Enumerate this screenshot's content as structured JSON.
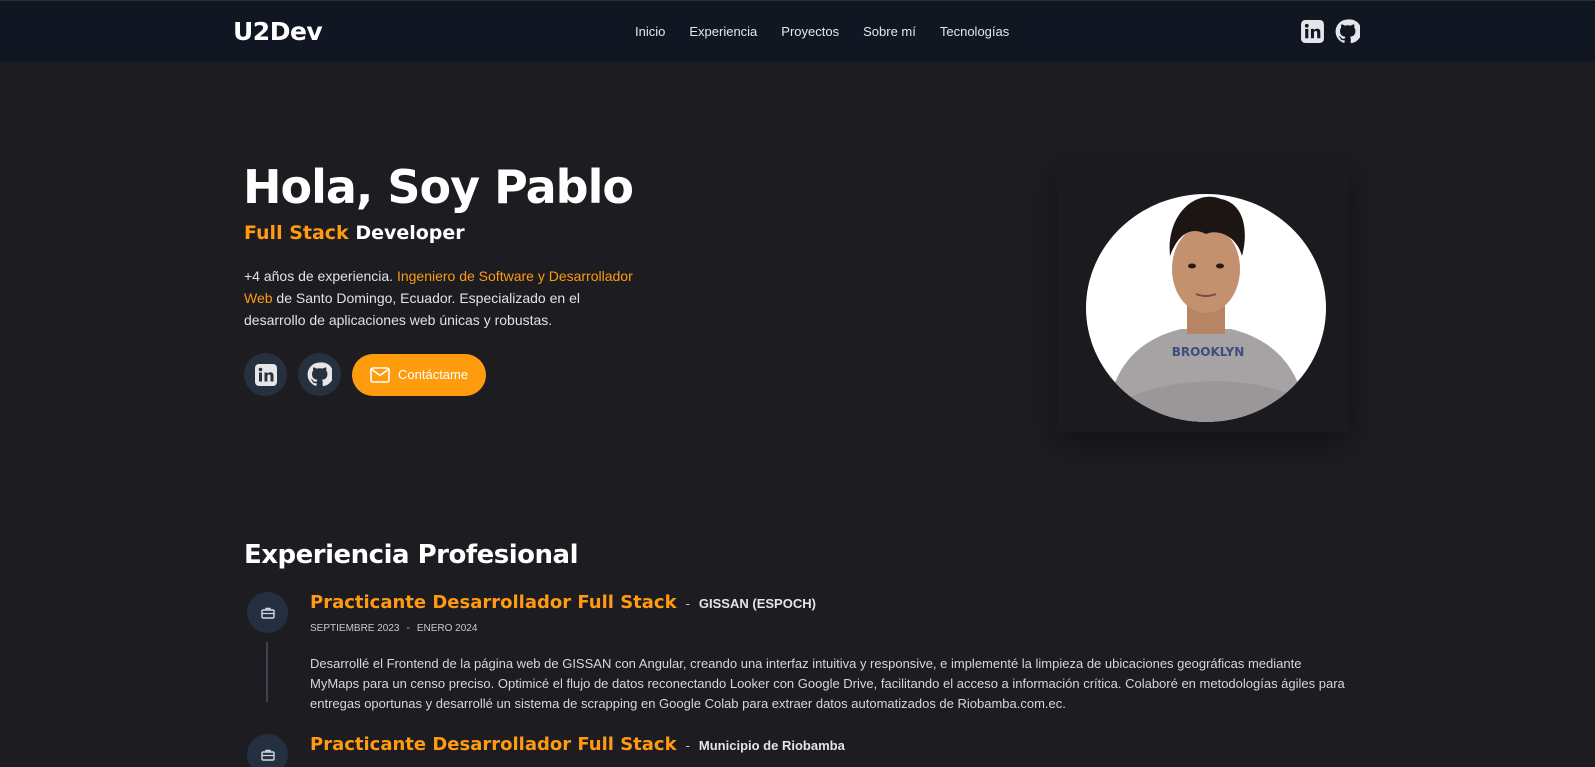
{
  "nav": {
    "brand": "U2Dev",
    "links": [
      "Inicio",
      "Experiencia",
      "Proyectos",
      "Sobre mí",
      "Tecnologías"
    ],
    "social_icons": [
      "linkedin-icon",
      "github-icon"
    ]
  },
  "hero": {
    "title": "Hola, Soy Pablo",
    "role_accent": "Full Stack",
    "role_rest": "Developer",
    "desc_part1": "+4 años de experiencia. ",
    "desc_accent": "Ingeniero de Software y Desarrollador Web",
    "desc_part2": " de Santo Domingo, Ecuador. Especializado en el desarrollo de aplicaciones web únicas y robustas.",
    "contact_label": "Contáctame"
  },
  "experience": {
    "title": "Experiencia Profesional",
    "items": [
      {
        "role": "Practicante Desarrollador Full Stack",
        "company": "GISSAN (ESPOCH)",
        "start": "SEPTIEMBRE 2023",
        "end": "ENERO 2024",
        "description": "Desarrollé el Frontend de la página web de GISSAN con Angular, creando una interfaz intuitiva y responsive, e implementé la limpieza de ubicaciones geográficas mediante MyMaps para un censo preciso. Optimicé el flujo de datos reconectando Looker con Google Drive, facilitando el acceso a información crítica. Colaboré en metodologías ágiles para entregas oportunas y desarrollé un sistema de scrapping en Google Colab para extraer datos automatizados de Riobamba.com.ec."
      },
      {
        "role": "Practicante Desarrollador Full Stack",
        "company": "Municipio de Riobamba"
      }
    ]
  },
  "colors": {
    "background": "#1c1c21",
    "navbar": "#111722",
    "accent": "#ff9a12",
    "icon_circle": "#243042"
  }
}
